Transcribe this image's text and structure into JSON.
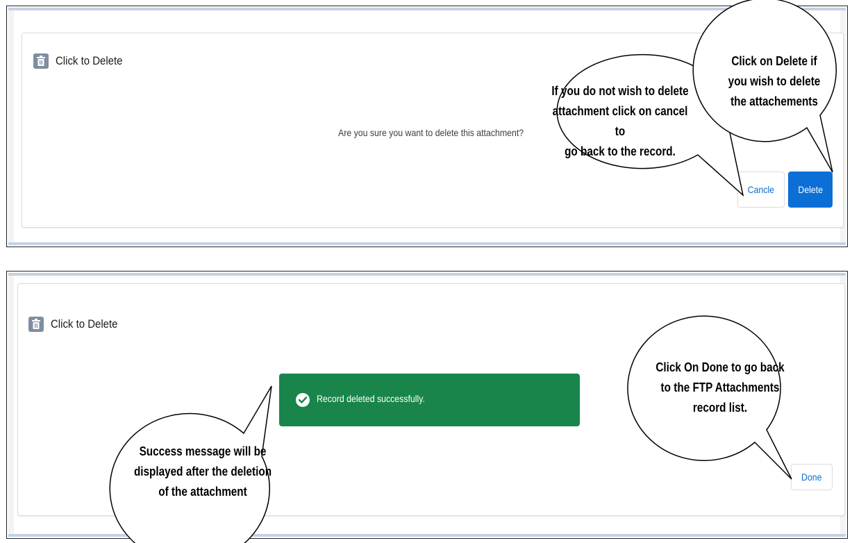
{
  "top_panel": {
    "title": "Click to Delete",
    "header_icon": "trash-icon",
    "prompt": "Are you sure you want to delete this attachment?",
    "cancel_label": "Cancle",
    "delete_label": "Delete"
  },
  "bottom_panel": {
    "title": "Click to Delete",
    "header_icon": "trash-icon",
    "toast_message": "Record deleted successfully.",
    "toast_icon": "check-circle-icon",
    "done_label": "Done"
  },
  "callouts": {
    "cancel_line1": "If you do not wish to delete",
    "cancel_line2": "attachment click on cancel to",
    "cancel_line3": "go back to the record.",
    "delete_line1": "Click on Delete if",
    "delete_line2": "you wish to delete",
    "delete_line3": "the attachements",
    "success_line1": "Success message will be",
    "success_line2": "displayed after the deletion",
    "success_line3": "of the attachment",
    "done_line1": "Click On Done to go back",
    "done_line2": "to the FTP Attachments",
    "done_line3": "record list."
  },
  "colors": {
    "primary_button": "#0b6fd6",
    "toast_success": "#19854b",
    "icon_tile": "#7f8da1",
    "link_text": "#0b6bcb"
  }
}
